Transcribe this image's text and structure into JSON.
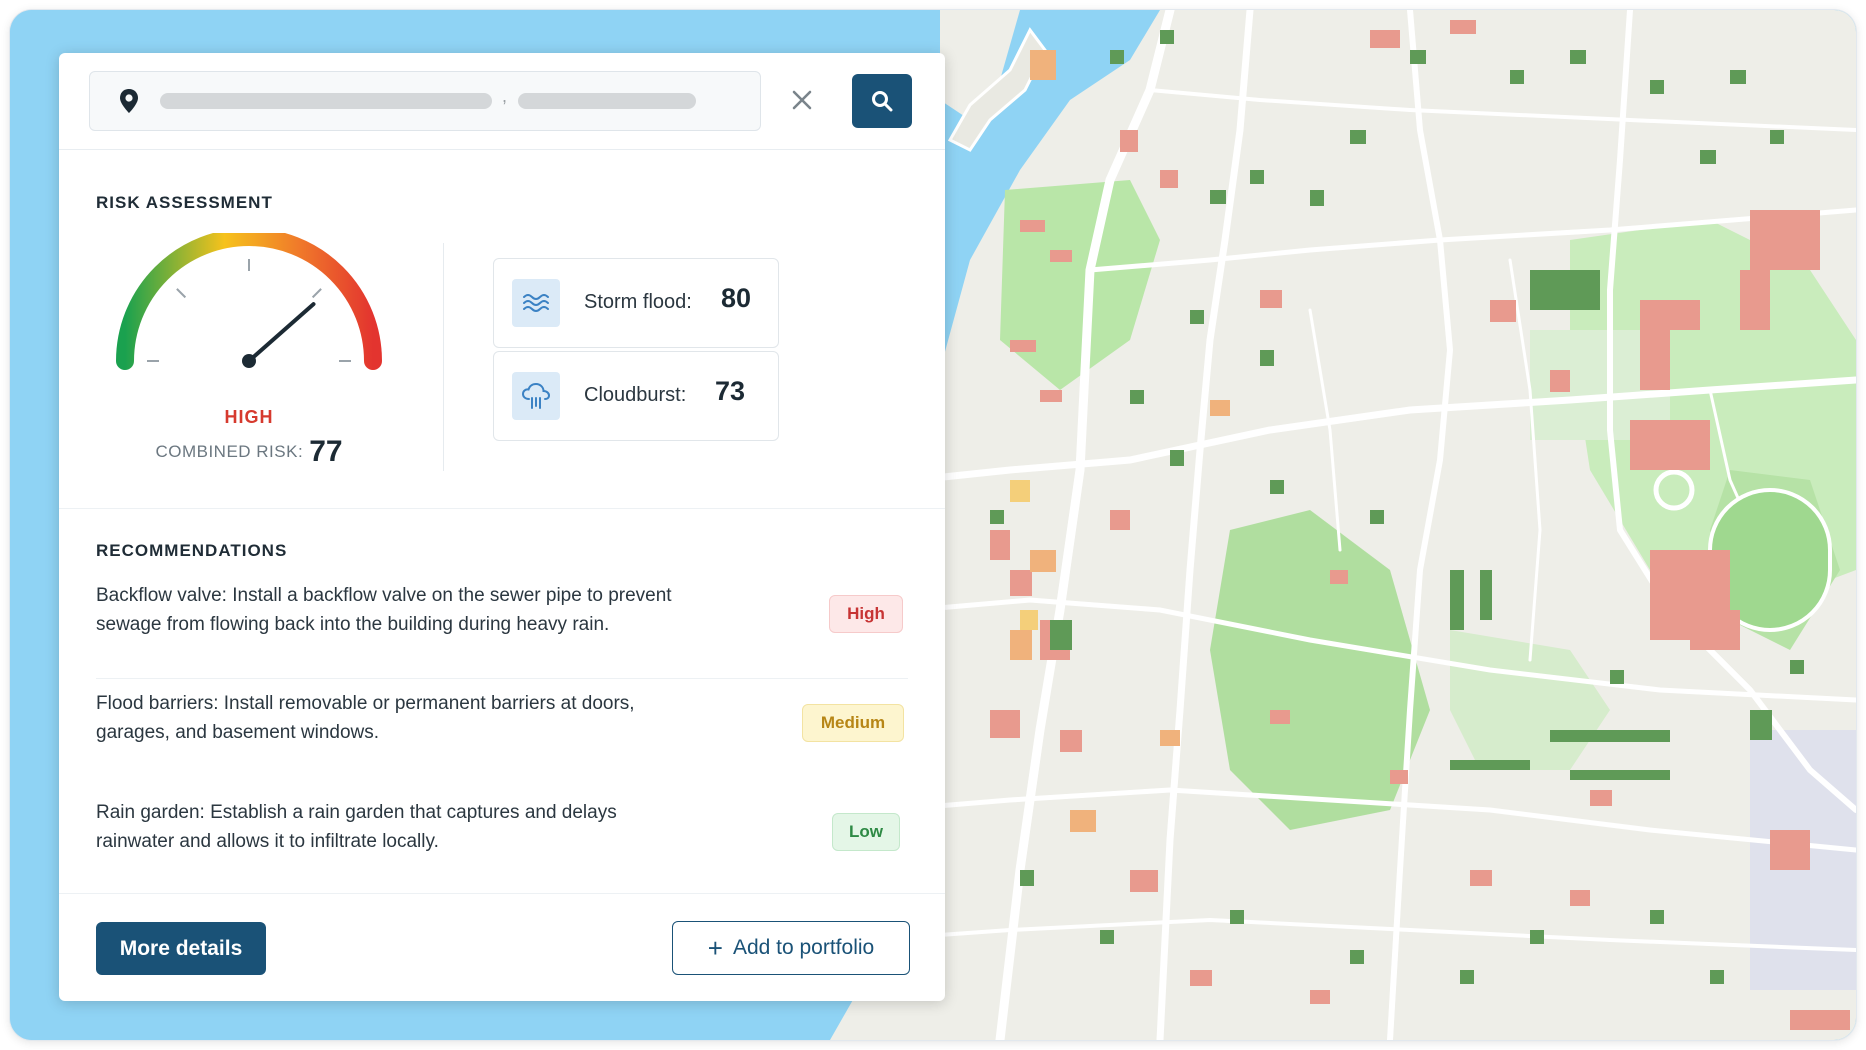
{
  "search": {
    "placeholder_segments": 2,
    "icons": {
      "location": "map-pin-icon",
      "clear": "close-icon",
      "submit": "search-icon"
    }
  },
  "risk_assessment": {
    "title": "RISK ASSESSMENT",
    "level_label": "HIGH",
    "combined_label": "COMBINED RISK:",
    "combined_value": "77",
    "gauge_value": 77,
    "gauge_max": 100,
    "gauge_colors": [
      "#1aa14f",
      "#f6c21c",
      "#f07a2a",
      "#e3342f"
    ],
    "metrics": [
      {
        "label": "Storm flood:",
        "value": "80",
        "icon": "waves-icon"
      },
      {
        "label": "Cloudburst:",
        "value": "73",
        "icon": "rain-cloud-icon"
      }
    ]
  },
  "recommendations": {
    "title": "RECOMMENDATIONS",
    "items": [
      {
        "line1": "Backflow valve: Install a backflow valve on the sewer pipe to prevent",
        "line2": "sewage from flowing back into the building during heavy rain.",
        "priority": "High"
      },
      {
        "line1": "Flood barriers: Install removable or permanent barriers at doors,",
        "line2": "garages, and basement windows.",
        "priority": "Medium"
      },
      {
        "line1": "Rain garden: Establish a rain garden that captures and delays",
        "line2": "rainwater and allows it to infiltrate locally.",
        "priority": "Low"
      }
    ]
  },
  "actions": {
    "more_details": "More details",
    "add_to_portfolio": "Add to portfolio"
  },
  "colors": {
    "primary": "#1a5277",
    "water": "#8fd3f4",
    "land": "#eeeee8",
    "park": "#b9e6a8",
    "building_red": "#e89a8e",
    "building_green": "#5f9a57",
    "badge_high": "#c73434",
    "badge_medium": "#b78616",
    "badge_low": "#2e8a45"
  }
}
